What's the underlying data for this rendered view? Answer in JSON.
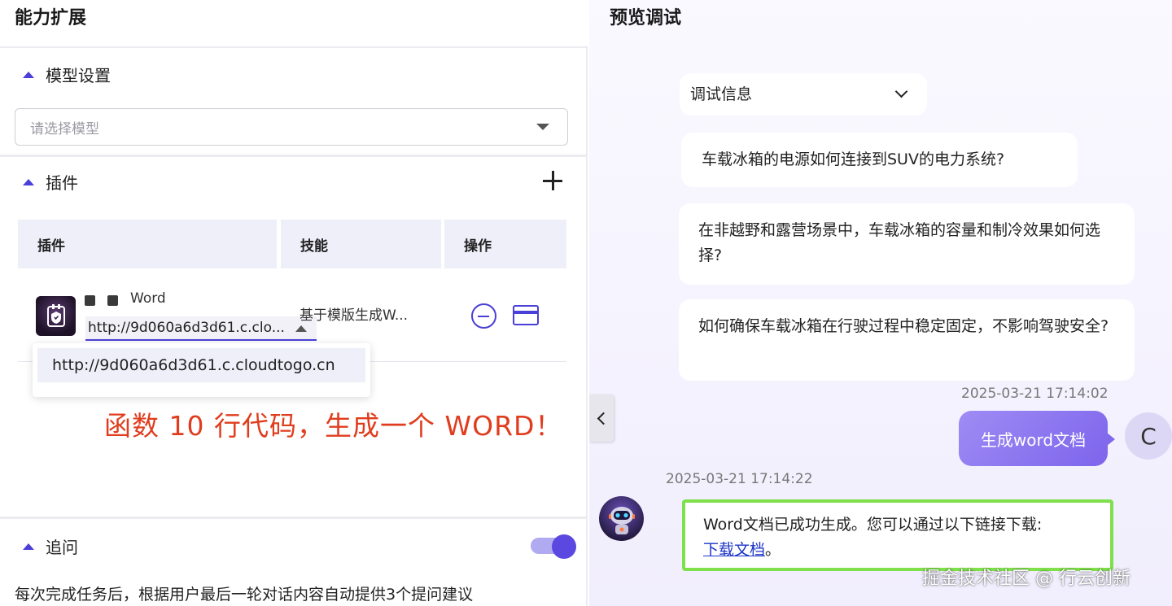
{
  "left_panel": {
    "title": "能力扩展",
    "model_settings": {
      "heading": "模型设置",
      "select_placeholder": "请选择模型"
    },
    "plugins": {
      "heading": "插件",
      "columns": [
        "插件",
        "技能",
        "操作"
      ],
      "rows": [
        {
          "name": "Word",
          "selected_url": "http://9d060a6d3d61.c.clo...",
          "skill": "基于模版生成W..."
        }
      ],
      "dropdown_option": "http://9d060a6d3d61.c.cloudtogo.cn"
    },
    "annotation": "函数 10 行代码，生成一个 WORD！",
    "follow_up": {
      "heading": "追问",
      "enabled": true,
      "description": "每次完成任务后，根据用户最后一轮对话内容自动提供3个提问建议"
    }
  },
  "right_panel": {
    "title": "预览调试",
    "debug_info_label": "调试信息",
    "suggestions": [
      "车载冰箱的电源如何连接到SUV的电力系统?",
      "在非越野和露营场景中，车载冰箱的容量和制冷效果如何选择?",
      "如何确保车载冰箱在行驶过程中稳定固定，不影响驾驶安全?"
    ],
    "user_timestamp": "2025-03-21 17:14:02",
    "user_message": "生成word文档",
    "user_avatar_letter": "C",
    "bot_timestamp": "2025-03-21 17:14:22",
    "bot_message_text": "Word文档已成功生成。您可以通过以下链接下载:",
    "bot_link_text": "下载文档",
    "bot_message_end": "。",
    "watermark": "掘金技术社区 @ 行云创新"
  },
  "colors": {
    "accent": "#4a3fd6",
    "annotation_red": "#e03d1e",
    "highlight_green": "#7ee04a",
    "user_bubble": "#8a73ef"
  }
}
